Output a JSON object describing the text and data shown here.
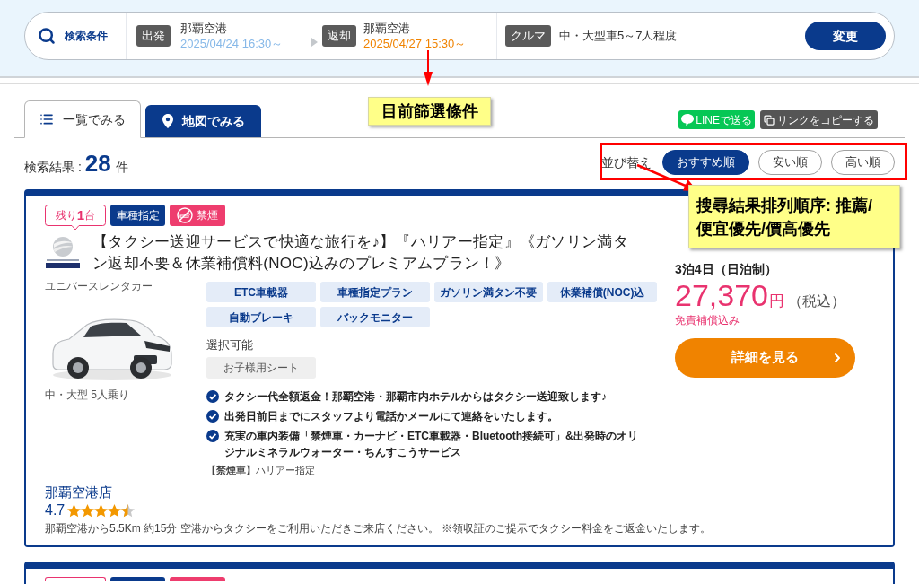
{
  "search_bar": {
    "label": "検索条件",
    "departure": {
      "tag": "出発",
      "place": "那覇空港",
      "datetime": "2025/04/24 16:30～"
    },
    "return": {
      "tag": "返却",
      "place": "那覇空港",
      "datetime": "2025/04/27 15:30～"
    },
    "car": {
      "tag": "クルマ",
      "value": "中・大型車5～7人程度"
    },
    "change_button": "変更"
  },
  "tabs": [
    {
      "label": "一覧でみる",
      "selected": true
    },
    {
      "label": "地図でみる",
      "selected": false
    }
  ],
  "share": {
    "line_button": "LINEで送る",
    "copy_link_button": "リンクをコピーする"
  },
  "results": {
    "label": "検索結果 :",
    "count": "28",
    "unit": "件"
  },
  "sort": {
    "label": "並び替え",
    "options": [
      {
        "label": "おすすめ順",
        "selected": true
      },
      {
        "label": "安い順",
        "selected": false
      },
      {
        "label": "高い順",
        "selected": false
      }
    ]
  },
  "listings": [
    {
      "badges": [
        {
          "kind": "stock",
          "label": "残り**1**台"
        },
        {
          "kind": "type",
          "label": "車種指定"
        },
        {
          "kind": "nosmoking",
          "label": "禁煙"
        }
      ],
      "title": "【タクシー送迎サービスで快適な旅行を♪】『ハリアー指定』《ガソリン満タン返却不要＆休業補償料(NOC)込みのプレミアムプラン！》",
      "company": "ユニバースレンタカー",
      "car_class": "中・大型 5人乗り",
      "features": [
        "ETC車載器",
        "車種指定プラン",
        "ガソリン満タン不要",
        "休業補償(NOC)込",
        "自動ブレーキ",
        "バックモニター"
      ],
      "options_label": "選択可能",
      "options": [
        "お子様用シート"
      ],
      "points": [
        "タクシー代全額返金！那覇空港・那覇市内ホテルからはタクシー送迎致します♪",
        "出発日前日までにスタッフより電話かメールにて連絡をいたします。",
        "充実の車内装備「禁煙車・カーナビ・ETC車載器・Bluetooth接続可」&出発時のオリジナルミネラルウォーター・ちんすこうサービス"
      ],
      "note": "**【禁煙車】**ハリアー指定",
      "shop": "那覇空港店",
      "rating": "4.7",
      "stars": 4.5,
      "access": "那覇空港から5.5Km 約15分 空港からタクシーをご利用いただきご来店ください。 ※領収証のご提示でタクシー料金をご返金いたします。",
      "stay": "3泊4日（日泊制）",
      "price": "27,370",
      "currency": "円",
      "tax": "（税込）",
      "insurance": "免責補償込み",
      "details_button": "詳細を見る"
    },
    {
      "badges": [
        {
          "kind": "stock"
        },
        {
          "kind": "type"
        },
        {
          "kind": "nosmoking"
        }
      ]
    }
  ],
  "annotations": {
    "filter_note": "目前篩選條件",
    "sort_note": [
      "搜尋結果排列順序: 推薦/",
      "便宜優先/價高優先"
    ]
  }
}
